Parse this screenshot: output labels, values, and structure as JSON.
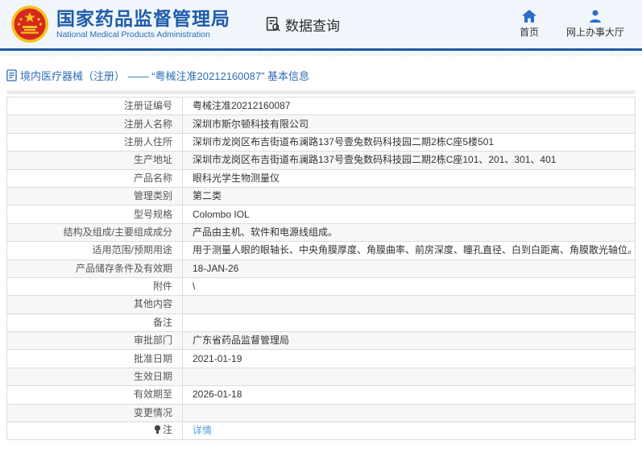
{
  "header": {
    "org_name_cn": "国家药品监督管理局",
    "org_name_en": "National Medical Products Administration",
    "section_title": "数据查询",
    "nav": [
      {
        "label": "首页",
        "icon": "home-icon"
      },
      {
        "label": "网上办事大厅",
        "icon": "person-icon"
      }
    ]
  },
  "breadcrumb": {
    "text": "境内医疗器械（注册） —— “粤械注准20212160087” 基本信息",
    "icon": "document-icon"
  },
  "table": {
    "rows": [
      {
        "label": "注册证编号",
        "value": "粤械注准20212160087"
      },
      {
        "label": "注册人名称",
        "value": "深圳市斯尔顿科技有限公司"
      },
      {
        "label": "注册人住所",
        "value": "深圳市龙岗区布吉街道布澜路137号壹兔数码科技园二期2栋C座5楼501"
      },
      {
        "label": "生产地址",
        "value": "深圳市龙岗区布吉街道布澜路137号壹兔数码科技园二期2栋C座101、201、301、401"
      },
      {
        "label": "产品名称",
        "value": "眼科光学生物测量仪"
      },
      {
        "label": "管理类别",
        "value": "第二类"
      },
      {
        "label": "型号规格",
        "value": "Colombo IOL"
      },
      {
        "label": "结构及组成/主要组成成分",
        "value": "产品由主机、软件和电源线组成。"
      },
      {
        "label": "适用范围/预期用途",
        "value": "用于测量人眼的眼轴长、中央角膜厚度、角膜曲率、前房深度、瞳孔直径、白到白距离、角膜散光轴位。"
      },
      {
        "label": "产品储存条件及有效期",
        "value": "18-JAN-26"
      },
      {
        "label": "附件",
        "value": "\\"
      },
      {
        "label": "其他内容",
        "value": ""
      },
      {
        "label": "备注",
        "value": ""
      },
      {
        "label": "审批部门",
        "value": "广东省药品监督管理局"
      },
      {
        "label": "批准日期",
        "value": "2021-01-19"
      },
      {
        "label": "生效日期",
        "value": ""
      },
      {
        "label": "有效期至",
        "value": "2026-01-18"
      },
      {
        "label": "变更情况",
        "value": ""
      },
      {
        "label": "注",
        "value": "详情",
        "link": true,
        "label_icon": "bulb-icon"
      }
    ]
  },
  "colors": {
    "brand_blue": "#1f5cab",
    "header_border_blue": "#1b5aa0",
    "breadcrumb_blue": "#2e6cb5",
    "link_blue": "#55a0e0",
    "emblem_red": "#d6281e",
    "emblem_gold": "#f5c31f",
    "row_alt_gray": "#f7f7f7",
    "table_border": "#dcdcdc"
  }
}
